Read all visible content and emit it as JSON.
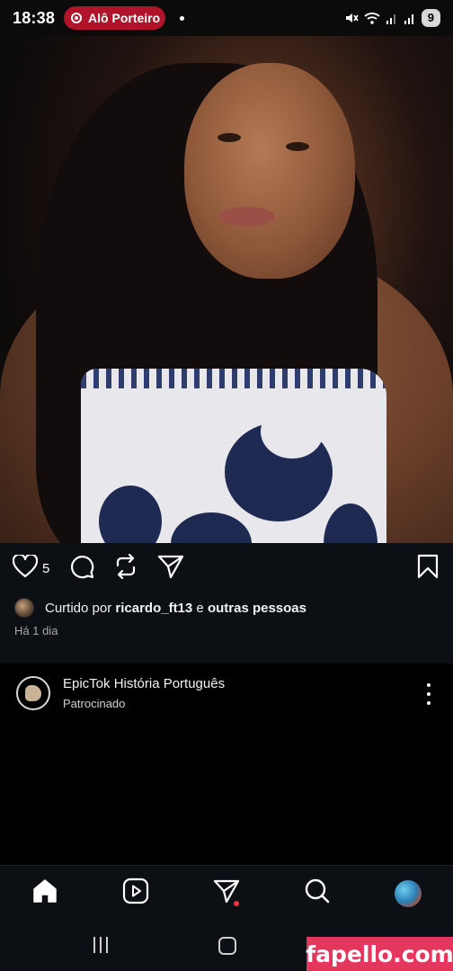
{
  "status_bar": {
    "time": "18:38",
    "notification_app": "Alô Porteiro",
    "battery": "9",
    "icons": [
      "mute-icon",
      "wifi-icon",
      "signal-icon",
      "signal-icon",
      "battery-icon"
    ]
  },
  "post": {
    "like_count": "5",
    "liked_by_prefix": "Curtido por ",
    "liked_by_user": "ricardo_ft13",
    "liked_by_joiner": " e ",
    "liked_by_others": "outras pessoas",
    "time_ago": "Há 1 dia"
  },
  "sponsored": {
    "account_name": "EpicTok História Português",
    "label": "Patrocinado"
  },
  "bottom_nav": {
    "items": [
      "home-icon",
      "reels-icon",
      "direct-icon",
      "search-icon",
      "profile-avatar"
    ]
  },
  "watermark": "fapello.com",
  "colors": {
    "accent_red": "#ff3040",
    "pill_red": "#b0142a",
    "background": "#0c1014",
    "watermark_pink": "#e5365e"
  }
}
